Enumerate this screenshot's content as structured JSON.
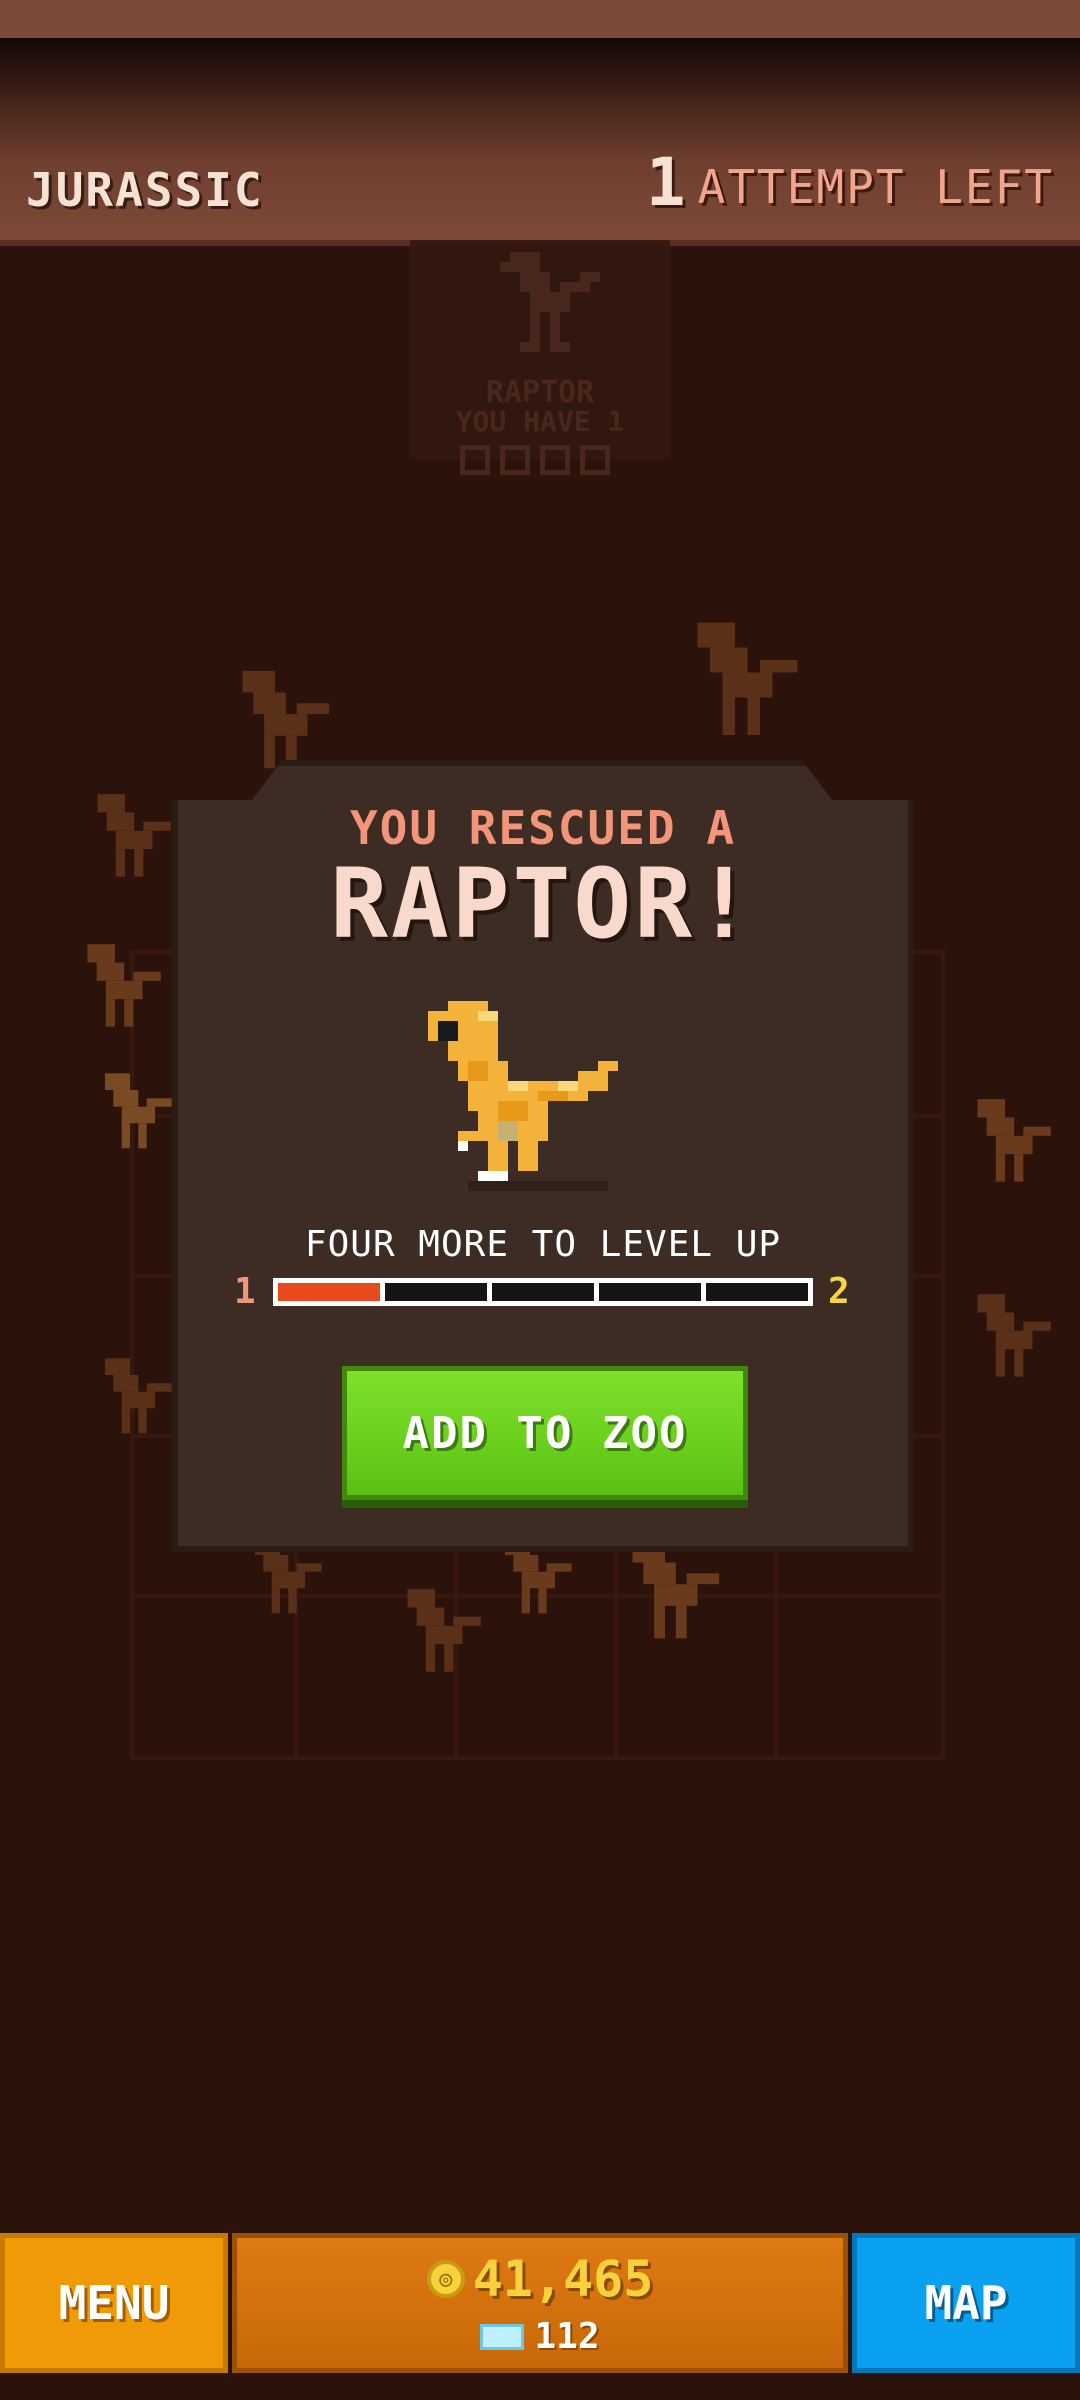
{
  "header": {
    "world_name": "JURASSIC",
    "attempts_count": "1",
    "attempts_label": "ATTEMPT LEFT"
  },
  "background_card": {
    "name": "RAPTOR",
    "owned": "YOU HAVE 1"
  },
  "modal": {
    "subtitle": "YOU RESCUED A",
    "title": "RAPTOR!",
    "level_text": "FOUR MORE TO LEVEL UP",
    "level_start": "1",
    "level_end": "2",
    "progress_segments_total": 5,
    "progress_segments_filled": 1,
    "button_label": "ADD TO ZOO",
    "dino_icon": "raptor-sprite"
  },
  "footer": {
    "menu_label": "MENU",
    "coins": "41,465",
    "gems": "112",
    "map_label": "MAP"
  },
  "colors": {
    "background": "#2b120b",
    "header": "#7e4a38",
    "modal": "#3d2c24",
    "button_green": "#6bd11e",
    "progress_fill": "#e94a1c",
    "menu_orange": "#f09a08",
    "map_blue": "#0aa2f0",
    "coin_gold": "#f8d23a"
  }
}
